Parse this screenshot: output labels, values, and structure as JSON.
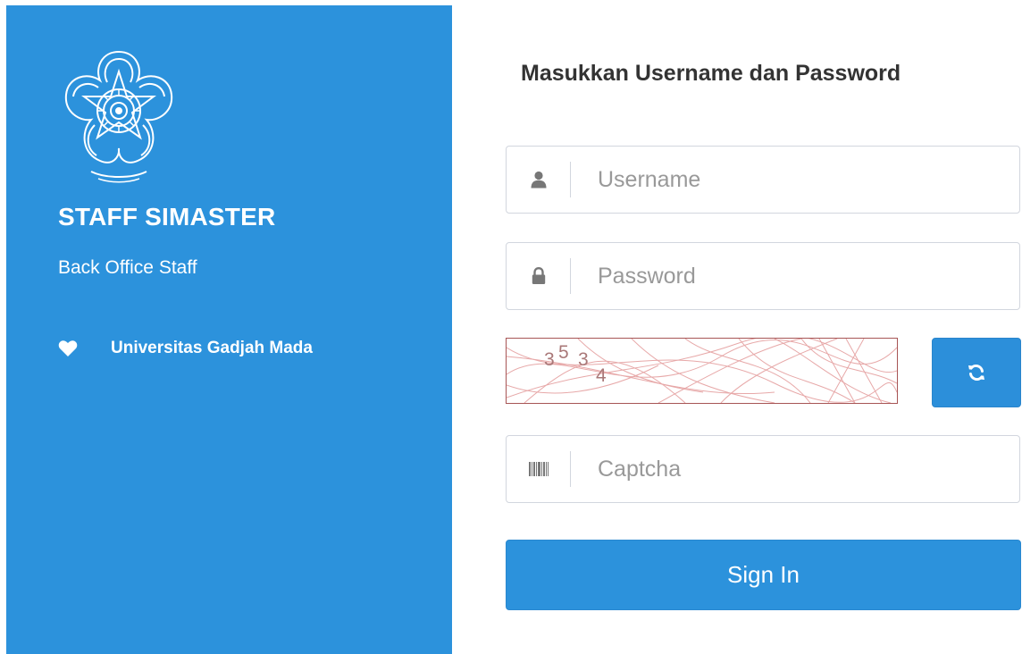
{
  "brand": {
    "app_title": "STAFF SIMASTER",
    "app_subtitle": "Back Office Staff",
    "university_name": "Universitas Gadjah Mada"
  },
  "login_form": {
    "title": "Masukkan Username dan Password",
    "username": {
      "value": "",
      "placeholder": "Username",
      "icon": "user-icon"
    },
    "password": {
      "value": "",
      "placeholder": "Password",
      "icon": "lock-icon"
    },
    "captcha": {
      "image_text": "3534",
      "refresh_icon": "refresh-icon",
      "input": {
        "value": "",
        "placeholder": "Captcha",
        "icon": "barcode-icon"
      }
    },
    "submit_label": "Sign In"
  },
  "colors": {
    "panel_blue": "#2c92dc",
    "button_blue": "#2c8fda",
    "input_border": "#d2d6de",
    "placeholder": "#999999",
    "title_text": "#333333",
    "captcha_noise": "#e08a8a"
  }
}
